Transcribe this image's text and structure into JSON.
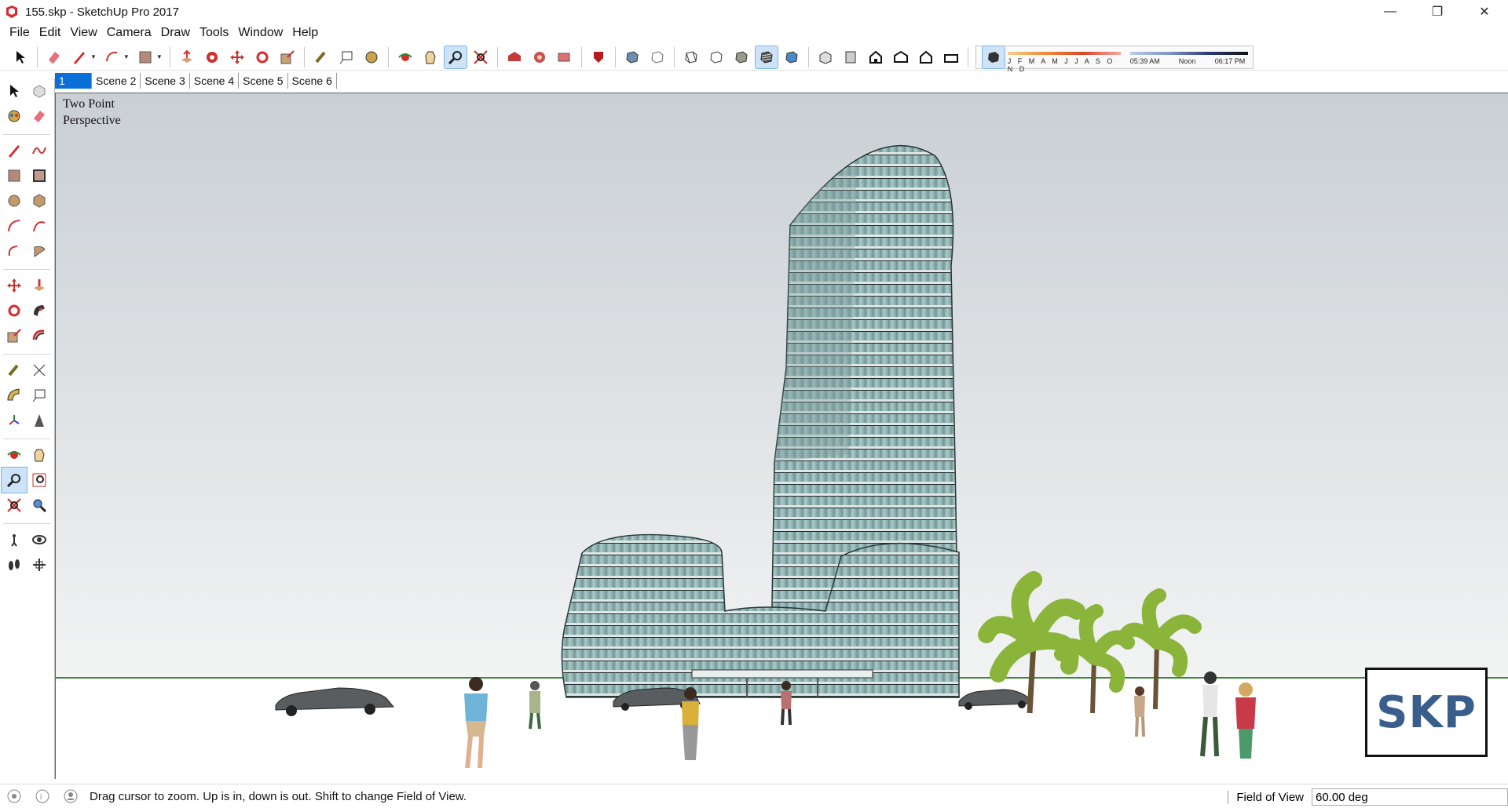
{
  "window": {
    "title": "155.skp - SketchUp Pro 2017",
    "minimize": "—",
    "maximize": "❐",
    "close": "✕"
  },
  "menu": [
    "File",
    "Edit",
    "View",
    "Camera",
    "Draw",
    "Tools",
    "Window",
    "Help"
  ],
  "shadow_settings": {
    "months": "J F M A M J J A S O N D",
    "time_start": "05:39 AM",
    "time_mid": "Noon",
    "time_end": "06:17 PM"
  },
  "scenes": [
    "1",
    "Scene 2",
    "Scene 3",
    "Scene 4",
    "Scene 5",
    "Scene 6"
  ],
  "viewport": {
    "camera_label_line1": "Two Point",
    "camera_label_line2": "Perspective",
    "logo_text": "SKP"
  },
  "status": {
    "message": "Drag cursor to zoom.  Up is in, down is out. Shift to change Field of View.",
    "measure_label": "Field of View",
    "measure_value": "60.00 deg"
  },
  "colors": {
    "active_blue": "#0a6fd8",
    "sky_top": "#c9cfd4",
    "ground": "#ffffff",
    "building_glass": "#8fb8b8",
    "palm_green": "#8ab43a"
  }
}
